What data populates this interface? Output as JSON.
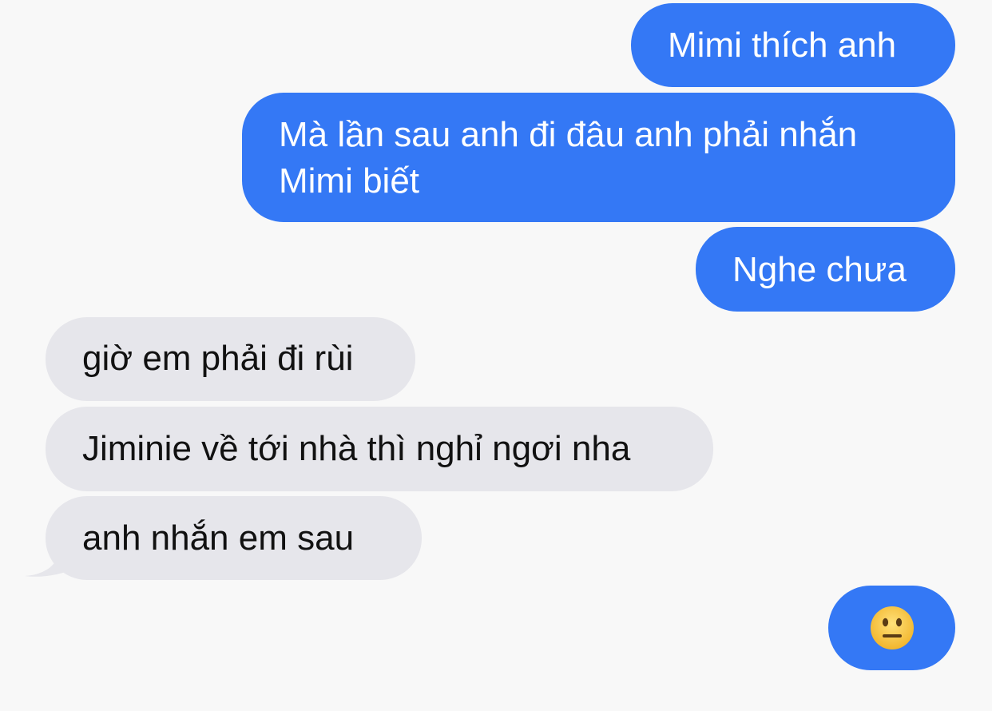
{
  "messages": [
    {
      "direction": "sent",
      "text": "Mimi thích anh"
    },
    {
      "direction": "sent",
      "lines": [
        "Mà lần sau anh đi đâu anh phải nhắn",
        "Mimi biết"
      ]
    },
    {
      "direction": "sent",
      "text": "Nghe chưa"
    },
    {
      "direction": "received",
      "text": "giờ em phải đi rùi"
    },
    {
      "direction": "received",
      "text": "Jiminie về tới nhà thì nghỉ ngơi nha"
    },
    {
      "direction": "received",
      "text": "anh nhắn em sau"
    },
    {
      "direction": "sent",
      "emoji": "neutral-face-emoji"
    }
  ],
  "colors": {
    "sent_bubble": "#3478f5",
    "received_bubble": "#e6e6eb",
    "background": "#f8f8f8",
    "emoji_face": "#f7c63c"
  }
}
